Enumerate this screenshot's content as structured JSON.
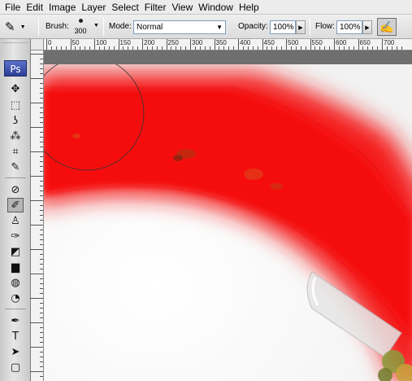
{
  "menu": [
    "File",
    "Edit",
    "Image",
    "Layer",
    "Select",
    "Filter",
    "View",
    "Window",
    "Help"
  ],
  "options": {
    "tool_preset_icon": "brush-icon",
    "brush_label": "Brush:",
    "brush_size": "300",
    "mode_label": "Mode:",
    "mode_value": "Normal",
    "opacity_label": "Opacity:",
    "opacity_value": "100%",
    "flow_label": "Flow:",
    "flow_value": "100%",
    "airbrush_icon": "airbrush-icon"
  },
  "ruler": {
    "labels": [
      "0",
      "50",
      "100",
      "150",
      "200",
      "250",
      "300",
      "350",
      "400",
      "450",
      "500",
      "550",
      "600",
      "650",
      "700"
    ]
  },
  "toolbox": {
    "logo": "Ps",
    "tools": [
      {
        "name": "move-tool",
        "glyph": "✥"
      },
      {
        "name": "marquee-tool",
        "glyph": "⬚"
      },
      {
        "name": "lasso-tool",
        "glyph": "ʖ"
      },
      {
        "name": "magic-wand-tool",
        "glyph": "⁂"
      },
      {
        "name": "crop-tool",
        "glyph": "⌗"
      },
      {
        "name": "eyedropper-tool",
        "glyph": "✎"
      },
      {
        "name": "healing-brush-tool",
        "glyph": "⊘"
      },
      {
        "name": "brush-tool",
        "glyph": "✐"
      },
      {
        "name": "clone-stamp-tool",
        "glyph": "♙"
      },
      {
        "name": "history-brush-tool",
        "glyph": "✑"
      },
      {
        "name": "eraser-tool",
        "glyph": "◩"
      },
      {
        "name": "gradient-tool",
        "glyph": "▆"
      },
      {
        "name": "blur-tool",
        "glyph": "◍"
      },
      {
        "name": "dodge-tool",
        "glyph": "◔"
      },
      {
        "name": "pen-tool",
        "glyph": "✒"
      },
      {
        "name": "type-tool",
        "glyph": "T"
      },
      {
        "name": "path-selection-tool",
        "glyph": "➤"
      },
      {
        "name": "shape-tool",
        "glyph": "▢"
      },
      {
        "name": "hand-tool",
        "glyph": "✋"
      }
    ]
  },
  "colors": {
    "paint_red": "#f41b1b",
    "ui_panel": "#dcdcdc",
    "pasteboard": "#6f6f6f"
  }
}
